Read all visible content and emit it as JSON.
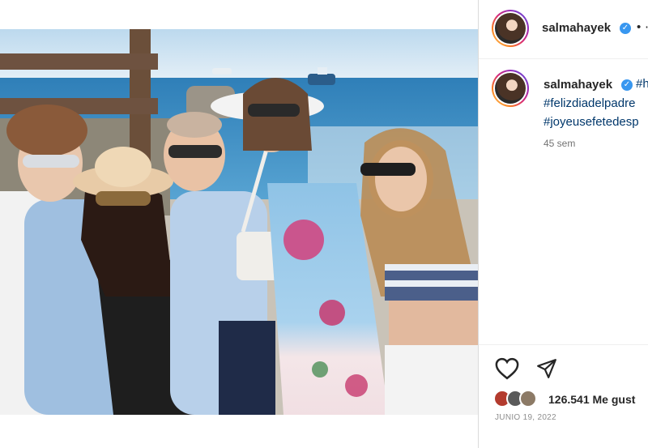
{
  "post": {
    "photo_icon": "group-photo-beach"
  },
  "header": {
    "username": "salmahayek",
    "verified_icon": "verified-badge-icon",
    "dot": "•",
    "more": "⋯"
  },
  "caption": {
    "username": "salmahayek",
    "hashtags": [
      "#h",
      "#felizdiadelpadre",
      "#joyeusefetedesp"
    ],
    "time": "45 sem"
  },
  "actions": {
    "like_icon": "heart-icon",
    "share_icon": "paper-plane-icon"
  },
  "likes": {
    "count_text": "126.541 Me gust"
  },
  "date": "JUNIO 19, 2022",
  "colors": {
    "link": "#00376b",
    "verified": "#3897f0",
    "text": "#262626",
    "muted": "#737373"
  }
}
